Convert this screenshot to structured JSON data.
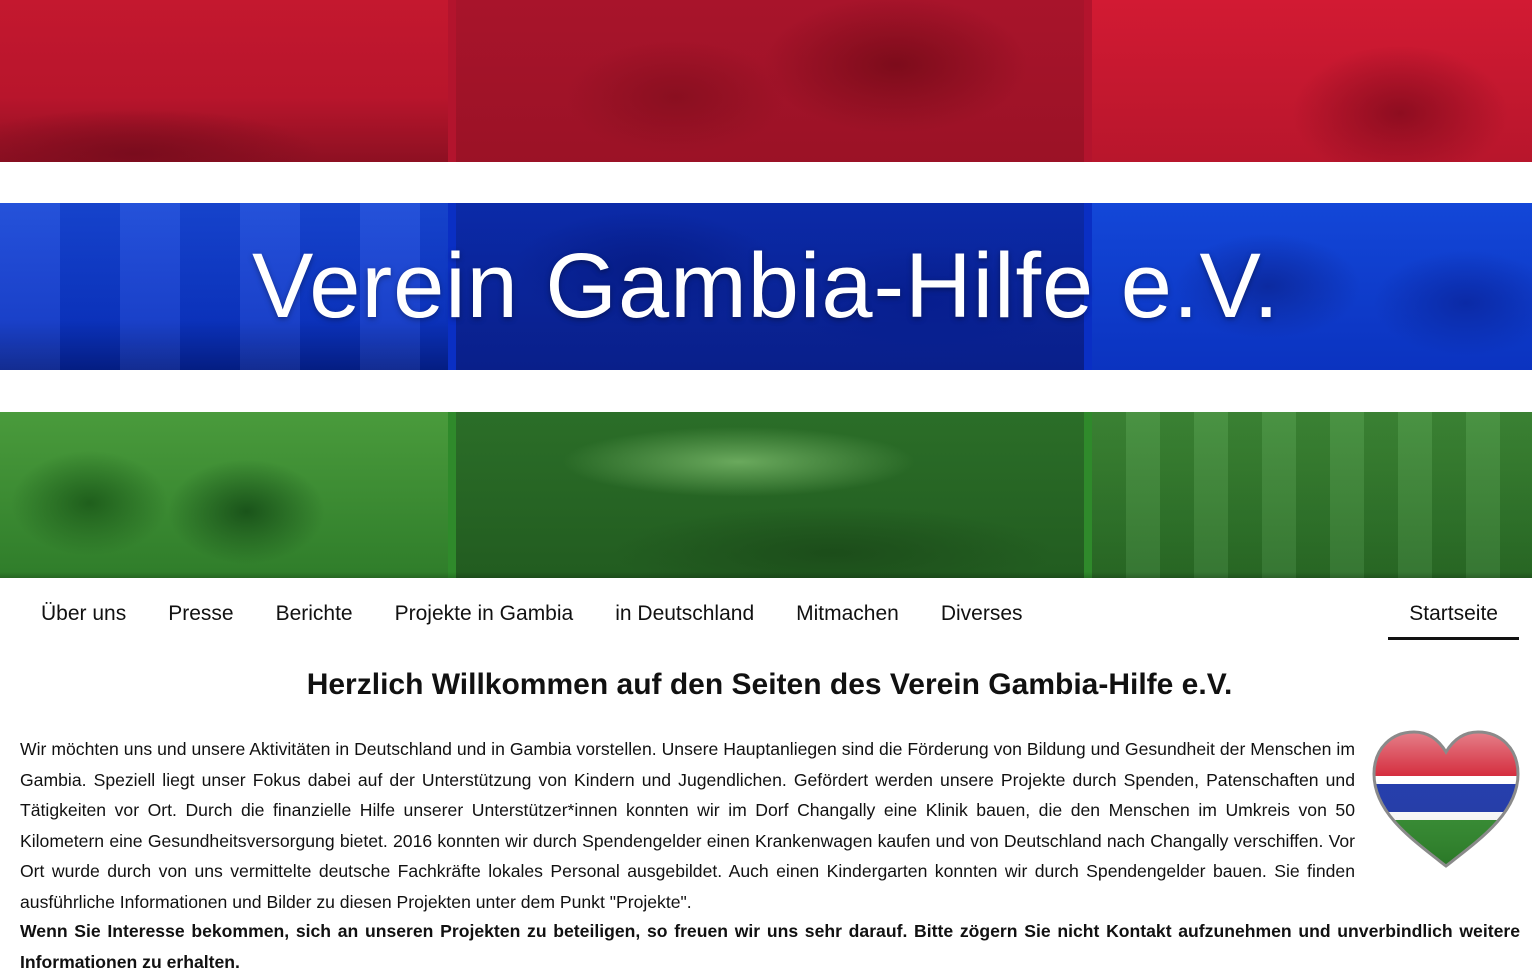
{
  "site": {
    "title": "Verein Gambia-Hilfe e.V."
  },
  "nav": {
    "items": [
      {
        "label": "Über uns"
      },
      {
        "label": "Presse"
      },
      {
        "label": "Berichte"
      },
      {
        "label": "Projekte in Gambia"
      },
      {
        "label": "in Deutschland"
      },
      {
        "label": "Mitmachen"
      },
      {
        "label": "Diverses"
      }
    ],
    "active": {
      "label": "Startseite"
    }
  },
  "content": {
    "heading": "Herzlich Willkommen auf den Seiten des Verein Gambia-Hilfe e.V.",
    "intro": "Wir möchten uns und unsere Aktivitäten in Deutschland und in Gambia vorstellen. Unsere Hauptanliegen sind die Förderung von Bildung und Gesundheit der Menschen im Gambia. Speziell liegt unser Fokus dabei auf der Unterstützung von Kindern und Jugendlichen. Gefördert werden unsere Projekte durch Spenden, Patenschaften und Tätigkeiten vor Ort. Durch die finanzielle Hilfe unserer Unterstützer*innen konnten wir im Dorf Changally eine Klinik bauen, die den Menschen im Umkreis von 50 Kilometern eine Gesundheitsversorgung bietet. 2016 konnten wir durch Spendengelder einen Krankenwagen kaufen und von Deutschland nach Changally verschiffen. Vor Ort wurde durch von uns vermittelte deutsche Fachkräfte lokales Personal ausgebildet. Auch einen Kindergarten konnten wir durch Spendengelder bauen. Sie finden ausführliche Informationen und Bilder zu diesen Projekten unter dem Punkt \"Projekte\".",
    "cta": "Wenn Sie Interesse bekommen, sich an unseren Projekten zu beteiligen, so freuen wir uns sehr darauf. Bitte zögern Sie nicht Kontakt aufzunehmen und unverbindlich weitere Informationen zu erhalten."
  },
  "icons": {
    "heart": "gambia-flag-heart-icon"
  },
  "colors": {
    "red": "#b3142d",
    "blue": "#0a2fc4",
    "green": "#2f8a2b",
    "white": "#ffffff",
    "text": "#111111"
  }
}
